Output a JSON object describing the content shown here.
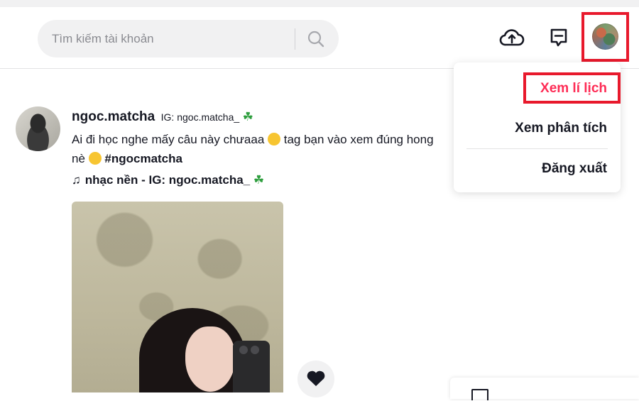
{
  "search": {
    "placeholder": "Tìm kiếm tài khoản"
  },
  "header_icons": [
    "upload-cloud-icon",
    "inbox-message-icon",
    "user-avatar"
  ],
  "colors": {
    "accent": "#fe2c55",
    "highlight_box": "#e8192c"
  },
  "profile_menu": {
    "view_profile": "Xem lí lịch",
    "view_analytics": "Xem phân tích",
    "logout": "Đăng xuất"
  },
  "post": {
    "author_name": "ngoc.matcha",
    "author_nick": "IG: ngoc.matcha_",
    "author_symbol": "☘",
    "caption_text": "Ai đi học nghe mấy câu này chưaaa",
    "caption_text_2": "tag bạn vào xem đúng hong nè",
    "hashtag": "#ngocmatcha",
    "music_symbol": "♫",
    "music_text": "nhạc nền - IG: ngoc.matcha_",
    "music_symbol_end": "☘"
  }
}
